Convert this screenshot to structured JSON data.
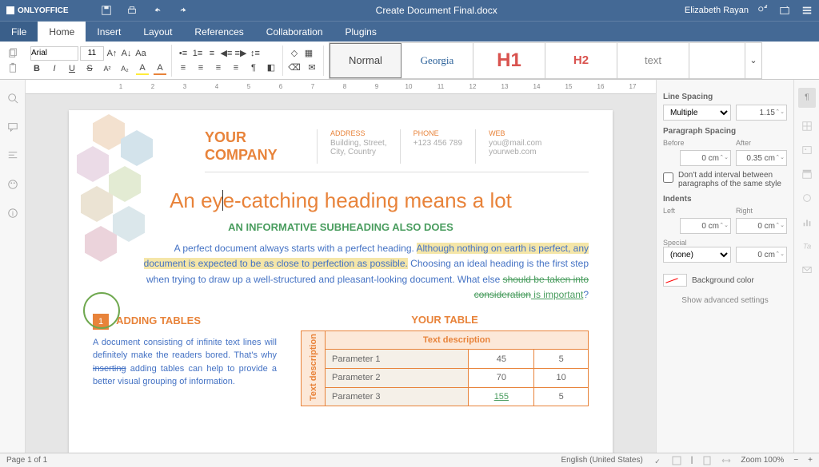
{
  "titlebar": {
    "app": "ONLYOFFICE",
    "doc": "Create Document Final.docx",
    "user": "Elizabeth Rayan"
  },
  "menu": {
    "file": "File",
    "tabs": [
      "Home",
      "Insert",
      "Layout",
      "References",
      "Collaboration",
      "Plugins"
    ],
    "active": "Home"
  },
  "ribbon": {
    "font_name": "Arial",
    "font_size": "11",
    "styles": [
      "Normal",
      "Georgia",
      "H1",
      "H2",
      "text"
    ]
  },
  "panel": {
    "line_spacing_label": "Line Spacing",
    "line_spacing_mode": "Multiple",
    "line_spacing_value": "1.15",
    "para_spacing_label": "Paragraph Spacing",
    "before": "Before",
    "after": "After",
    "before_val": "0 cm",
    "after_val": "0.35 cm",
    "check_label": "Don't add interval between paragraphs of the same style",
    "indents_label": "Indents",
    "left_l": "Left",
    "right_l": "Right",
    "left_v": "0 cm",
    "right_v": "0 cm",
    "special_l": "Special",
    "special_v": "(none)",
    "special_by": "0 cm",
    "bg_label": "Background color",
    "adv": "Show advanced settings"
  },
  "doc": {
    "company1": "YOUR",
    "company2": "COMPANY",
    "addr_l": "ADDRESS",
    "addr_v1": "Building, Street,",
    "addr_v2": "City, Country",
    "phone_l": "PHONE",
    "phone_v": "+123 456 789",
    "web_l": "WEB",
    "web_v1": "you@mail.com",
    "web_v2": "yourweb.com",
    "h1": "An eye-catching heading means a lot",
    "h2": "AN INFORMATIVE SUBHEADING ALSO DOES",
    "p1_a": "A perfect document always starts with a perfect heading. ",
    "p1_hl": "Although nothing on earth is perfect, any document is expected to be as close to perfection as possible.",
    "p1_b": " Choosing an ideal heading is the first step when trying to draw up a well-structured and pleasant-looking document. What else ",
    "p1_strike": "should be taken into consideration",
    "p1_green": " is important",
    "p1_q": "?",
    "sec1_num": "1",
    "sec1_title": "ADDING TABLES",
    "sec1_body_a": "A document consisting of infinite text lines will definitely make the readers bored. That's why ",
    "sec1_strike": "inserting",
    "sec1_body_b": " adding tables can help to provide a better visual grouping of information.",
    "table_title": "YOUR TABLE",
    "table_header": "Text description",
    "side_label": "Text description",
    "rows": [
      {
        "p": "Parameter 1",
        "a": "45",
        "b": "5"
      },
      {
        "p": "Parameter 2",
        "a": "70",
        "b": "10"
      },
      {
        "p": "Parameter 3",
        "a": "155",
        "b": "5"
      }
    ]
  },
  "chart_data": {
    "type": "table",
    "title": "YOUR TABLE",
    "header": "Text description",
    "rows": [
      {
        "parameter": "Parameter 1",
        "col1": 45,
        "col2": 5
      },
      {
        "parameter": "Parameter 2",
        "col1": 70,
        "col2": 10
      },
      {
        "parameter": "Parameter 3",
        "col1": 155,
        "col2": 5
      }
    ]
  },
  "status": {
    "page": "Page 1 of 1",
    "lang": "English (United States)",
    "zoom": "Zoom 100%"
  }
}
